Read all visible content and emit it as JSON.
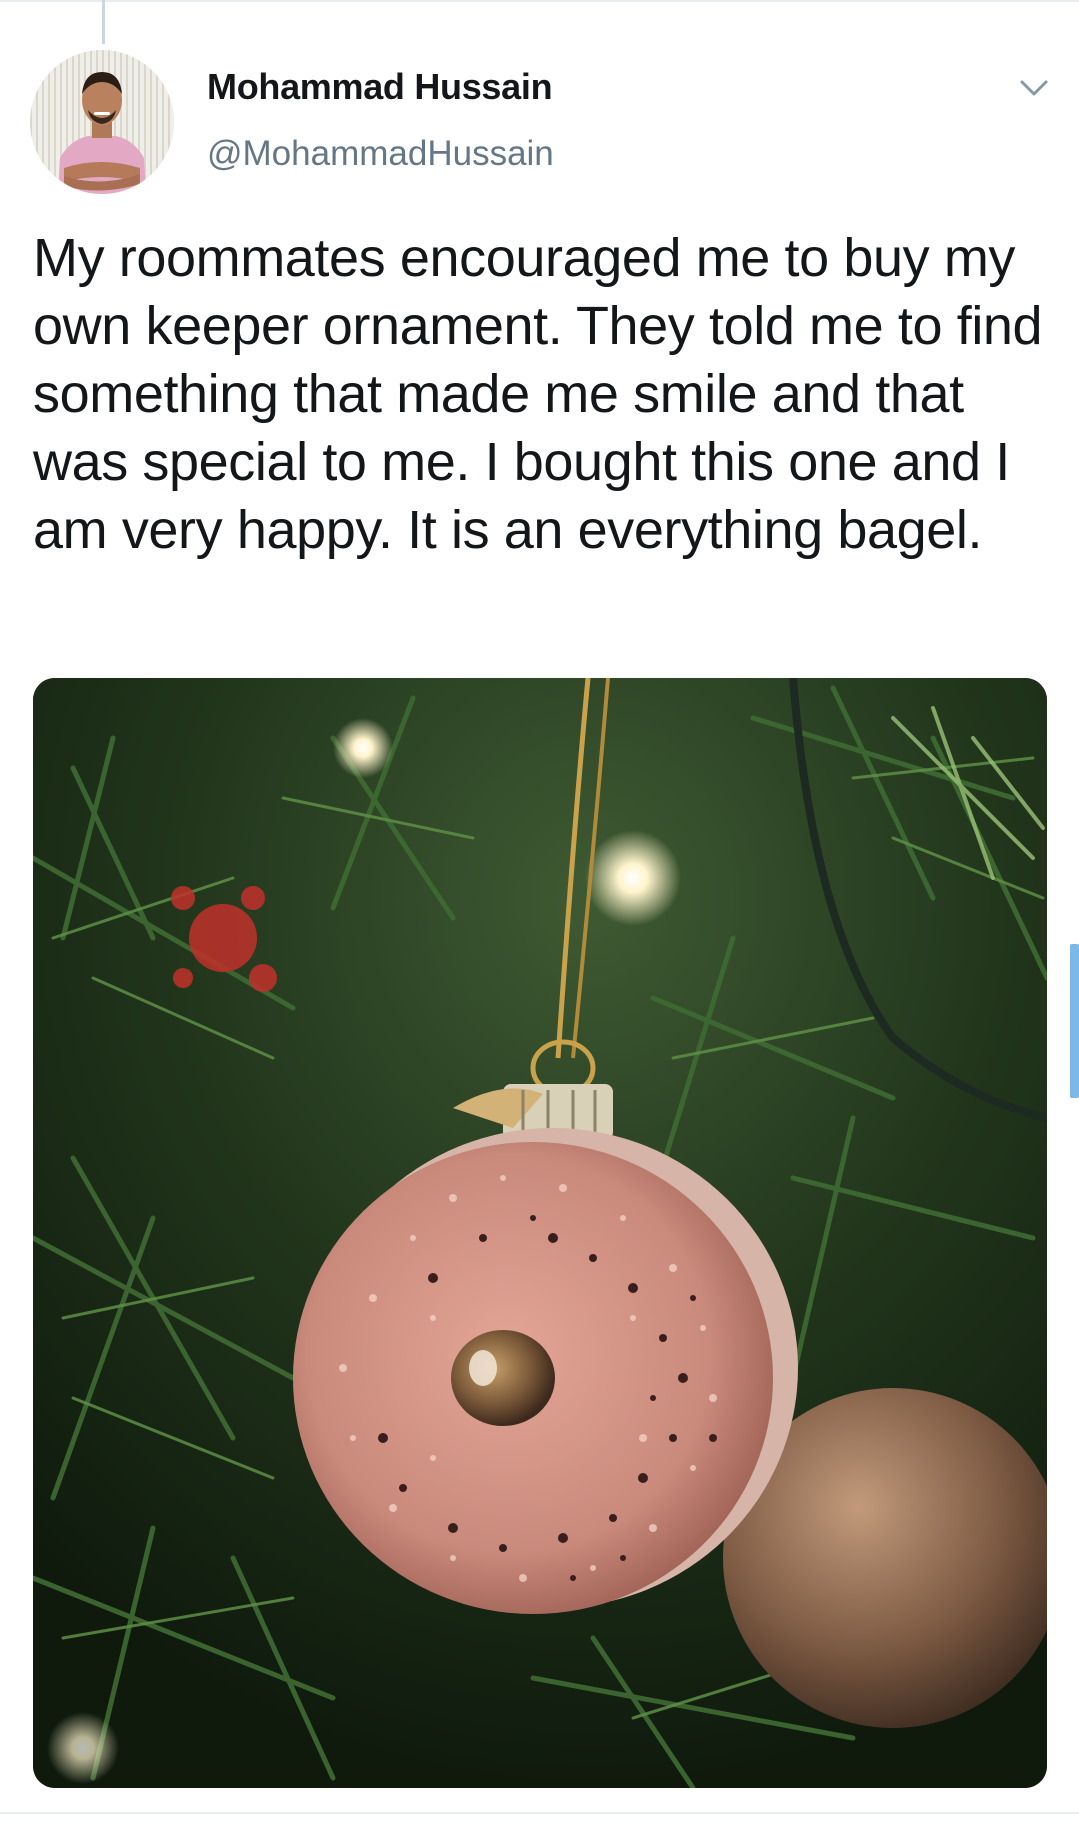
{
  "tweet": {
    "author": {
      "display_name": "Mohammad Hussain",
      "handle": "@MohammadHussain",
      "avatar_icon": "profile-photo"
    },
    "text": "My roommates encouraged me to buy my own keeper ornament. They told me to find something that made me smile and that was special to me. I bought this one and I am very happy. It is an everything bagel.",
    "menu_icon": "chevron-down-icon",
    "media": {
      "kind": "photo",
      "subject": "everything bagel ornament on christmas tree"
    }
  },
  "colors": {
    "text": "#14171a",
    "secondary_text": "#657786",
    "border": "#e6ecf0",
    "scroll_accent": "#7db9e8"
  }
}
